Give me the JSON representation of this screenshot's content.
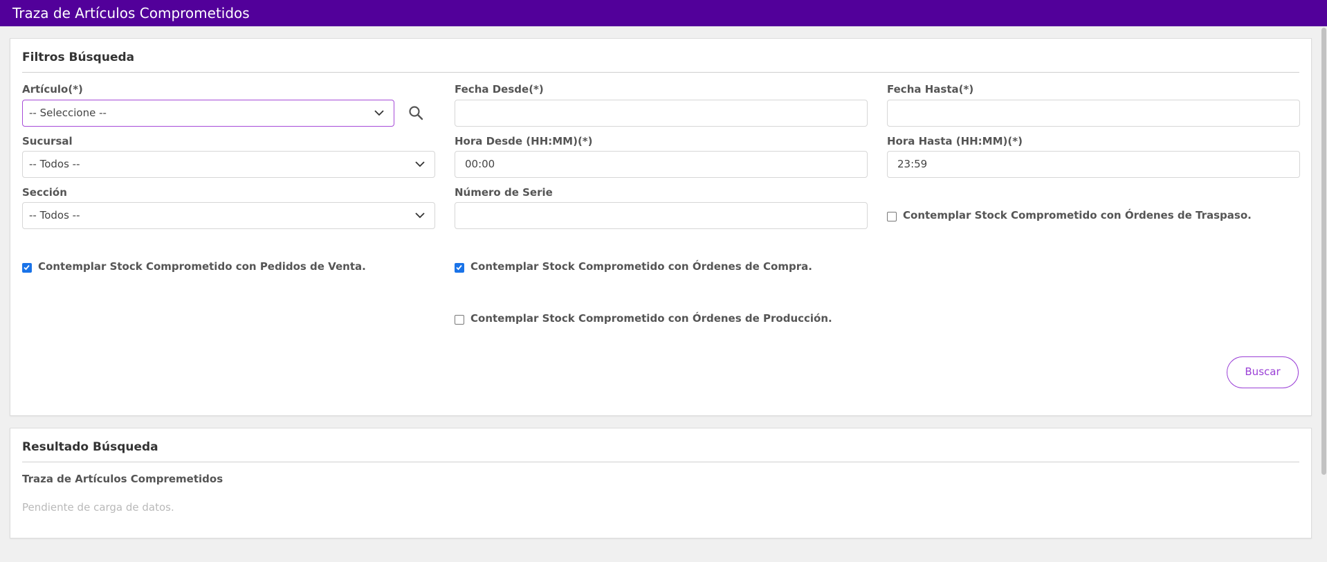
{
  "header": {
    "title": "Traza de Artículos Comprometidos"
  },
  "filters": {
    "title": "Filtros Búsqueda",
    "articulo": {
      "label": "Artículo(*)",
      "value": "-- Seleccione --"
    },
    "fecha_desde": {
      "label": "Fecha Desde(*)",
      "value": ""
    },
    "fecha_hasta": {
      "label": "Fecha Hasta(*)",
      "value": ""
    },
    "sucursal": {
      "label": "Sucursal",
      "value": "-- Todos --"
    },
    "hora_desde": {
      "label": "Hora Desde (HH:MM)(*)",
      "value": "00:00"
    },
    "hora_hasta": {
      "label": "Hora Hasta (HH:MM)(*)",
      "value": "23:59"
    },
    "seccion": {
      "label": "Sección",
      "value": "-- Todos --"
    },
    "numero_serie": {
      "label": "Número de Serie",
      "value": ""
    },
    "checks": {
      "traspaso": {
        "label": "Contemplar Stock Comprometido con Órdenes de Traspaso.",
        "checked": false
      },
      "pedidos_venta": {
        "label": "Contemplar Stock Comprometido con Pedidos de Venta.",
        "checked": true
      },
      "ordenes_compra": {
        "label": "Contemplar Stock Comprometido con Órdenes de Compra.",
        "checked": true
      },
      "ordenes_produccion": {
        "label": "Contemplar Stock Comprometido con Órdenes de Producción.",
        "checked": false
      }
    },
    "buscar_label": "Buscar"
  },
  "results": {
    "title": "Resultado Búsqueda",
    "subtitle": "Traza de Artículos Compremetidos",
    "empty_message": "Pendiente de carga de datos."
  },
  "colors": {
    "header_bg": "#52009a",
    "accent": "#9a3fd6",
    "checkbox_checked": "#1a73e8"
  },
  "icons": {
    "search": "search-icon",
    "dropdown": "chevron-down-icon",
    "check": "check-icon"
  }
}
